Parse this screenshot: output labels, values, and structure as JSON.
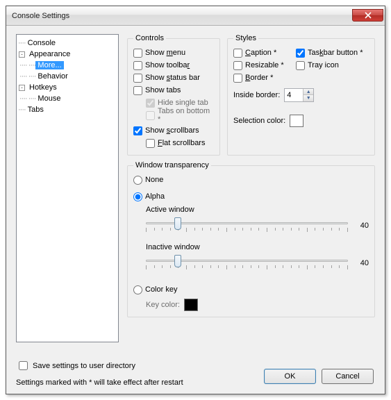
{
  "window": {
    "title": "Console Settings"
  },
  "tree": {
    "console": "Console",
    "appearance": "Appearance",
    "more": "More...",
    "behavior": "Behavior",
    "hotkeys": "Hotkeys",
    "mouse": "Mouse",
    "tabs": "Tabs"
  },
  "controls": {
    "legend": "Controls",
    "show_menu": "Show ",
    "menu_u": "m",
    "menu_rest": "enu",
    "show_toolbar": "Show toolba",
    "toolbar_u": "r",
    "show_statusbar_pre": "Show ",
    "status_u": "s",
    "status_rest": "tatus bar",
    "show_tabs": "Show tabs",
    "hide_single": "Hide single tab",
    "tabs_bottom": "Tabs on bottom *",
    "show_scroll_pre": "Show ",
    "scroll_u": "s",
    "scroll_rest": "crollbars",
    "flat_pre": "",
    "flat_u": "F",
    "flat_rest": "lat scrollbars"
  },
  "styles": {
    "legend": "Styles",
    "caption_u": "C",
    "caption_rest": "aption *",
    "resizable": "Resizable *",
    "border_u": "B",
    "border_rest": "order *",
    "taskbar_pre": "Tas",
    "taskbar_u": "k",
    "taskbar_rest": "bar button *",
    "trayicon": "Tray icon",
    "inside_border": "Inside border:",
    "ib_value": "4",
    "selection_color": "Selection color:"
  },
  "trans": {
    "legend": "Window transparency",
    "none_u": "N",
    "none_rest": "one",
    "alpha_u": "A",
    "alpha_rest": "lpha",
    "active": "Active window",
    "inactive_pre": "",
    "inactive_u": "I",
    "inactive_rest": "nactive window",
    "active_val": "40",
    "inactive_val": "40",
    "colorkey": "Color key",
    "keycolor": "Key color:"
  },
  "bottom": {
    "save": "Save settings to user directory",
    "note": "Settings marked with * will take effect after restart",
    "ok": "OK",
    "cancel": "Cancel"
  }
}
